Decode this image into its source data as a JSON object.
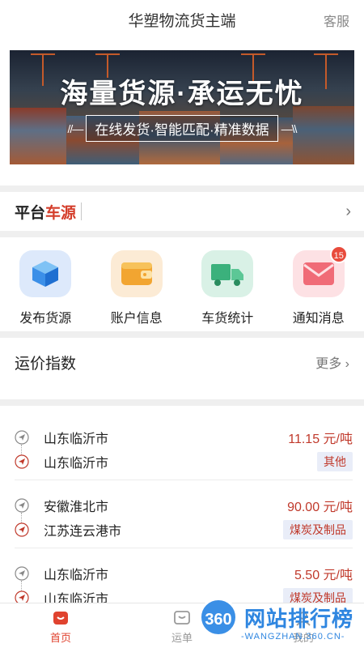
{
  "header": {
    "title": "华塑物流货主端",
    "service": "客服"
  },
  "banner": {
    "headline": "海量货源·承运无忧",
    "sub": "在线发货·智能匹配·精准数据",
    "slash_left": "//—",
    "slash_right": "—\\\\"
  },
  "platform": {
    "part1": "平台",
    "part2": "车源",
    "chevron": "›"
  },
  "grid": [
    {
      "label": "发布货源",
      "icon": "box-icon",
      "bg": "#dde9fb"
    },
    {
      "label": "账户信息",
      "icon": "wallet-icon",
      "bg": "#fcebd5"
    },
    {
      "label": "车货统计",
      "icon": "truck-icon",
      "bg": "#d9f1e6"
    },
    {
      "label": "通知消息",
      "icon": "envelope-icon",
      "bg": "#fde1e4",
      "badge": "15"
    }
  ],
  "freight_index": {
    "title": "运价指数",
    "more": "更多 ›"
  },
  "routes": [
    {
      "from": "山东临沂市",
      "to": "山东临沂市",
      "price": "11.15 元/吨",
      "tag": "其他"
    },
    {
      "from": "安徽淮北市",
      "to": "江苏连云港市",
      "price": "90.00 元/吨",
      "tag": "煤炭及制品"
    },
    {
      "from": "山东临沂市",
      "to": "山东临沂市",
      "price": "5.50 元/吨",
      "tag": "煤炭及制品"
    }
  ],
  "tabs": [
    {
      "label": "首页",
      "active": true
    },
    {
      "label": "运单",
      "active": false
    },
    {
      "label": "我的",
      "active": false
    }
  ],
  "watermark": {
    "badge": "360",
    "title": "网站排行榜",
    "sub": "-WANGZHAN.360.CN-"
  },
  "colors": {
    "accent": "#e0432f",
    "price": "#c0392b",
    "tag_bg": "#e9edf8"
  }
}
